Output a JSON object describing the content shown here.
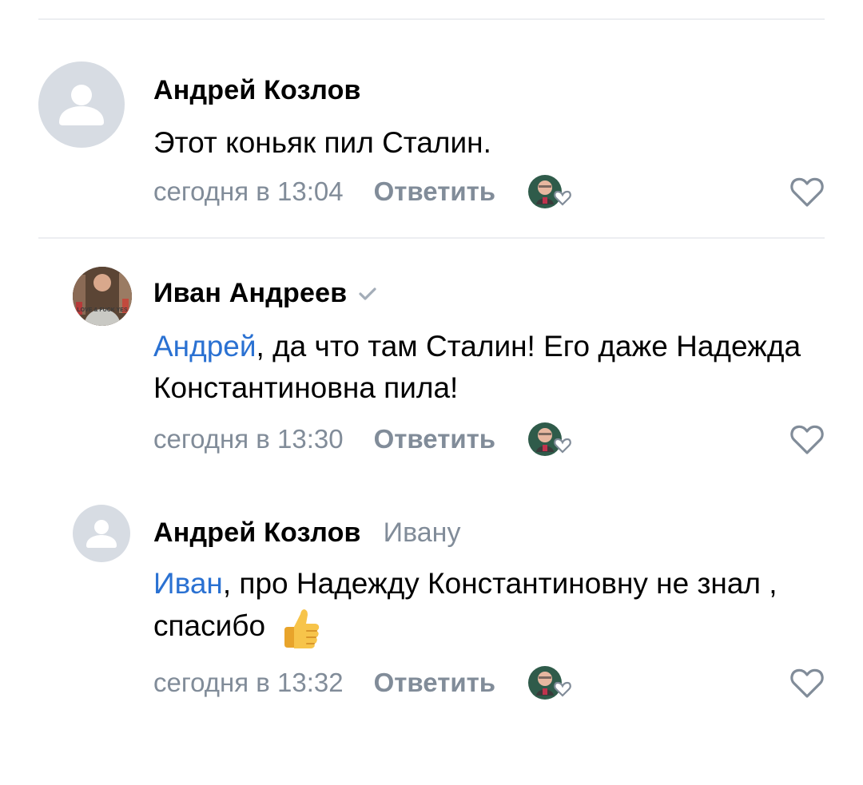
{
  "comments": [
    {
      "author": "Андрей Козлов",
      "text": "Этот коньяк пил Сталин.",
      "time": "сегодня в 13:04",
      "reply_label": "Ответить"
    },
    {
      "author": "Иван Андреев",
      "mention": "Андрей",
      "text_after_mention": ", да что там Сталин! Его даже Надежда Константиновна пила!",
      "time": "сегодня в 13:30",
      "reply_label": "Ответить",
      "avatar_shirt_text": "LOVE & FUCK YES"
    },
    {
      "author": "Андрей Козлов",
      "reply_to": "Ивану",
      "mention": "Иван",
      "text_after_mention": ", про Надежду Константиновну не знал , спасибо",
      "emoji": "👍",
      "time": "сегодня в 13:32",
      "reply_label": "Ответить"
    }
  ],
  "colors": {
    "accent": "#2a71d2",
    "secondary_text": "#818c99",
    "avatar_placeholder": "#d7dce3",
    "divider": "#eceef1"
  },
  "icons": {
    "avatar_placeholder": "user-silhouette-icon",
    "verified": "checkmark-icon",
    "like": "heart-outline-icon",
    "liker": "liker-avatar-heart-icon"
  }
}
